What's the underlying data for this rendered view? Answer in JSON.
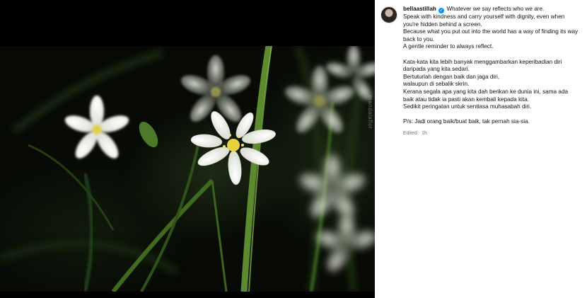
{
  "post": {
    "username": "bellaastillah",
    "verified": true,
    "watermark": "mandalaflor",
    "caption_lines": [
      "Whatever we say reflects who we are.",
      "Speak with kindness and carry yourself with dignity, even when you're hidden behind a screen.",
      "Because what you put out into the world has a way of finding its way back to you.",
      "A gentle reminder to always reflect."
    ],
    "caption_lines_ms": [
      "Kata-kata kita lebih banyak menggambarkan keperibadian diri daripada yang kita sedari.",
      "Bertuturlah dengan baik dan jaga diri,",
      "walaupun di sebalik skrin.",
      "Kerana segala apa yang kita dah berikan ke dunia ini, sama ada baik atau tidak ia pasti akan kembali kepada kita.",
      "Sedikit peringatan untuk sentiasa muhasabah diri."
    ],
    "ps_line": "P/s: Jadi orang baik/buat baik, tak pernah sia-sia.",
    "edited_label": "Edited",
    "time_ago": "1h"
  },
  "colors": {
    "verified_badge": "#0095f6",
    "panel_bg": "#ffffff",
    "meta_text": "#737373"
  },
  "icons": {
    "verified": "verified-badge-icon"
  }
}
